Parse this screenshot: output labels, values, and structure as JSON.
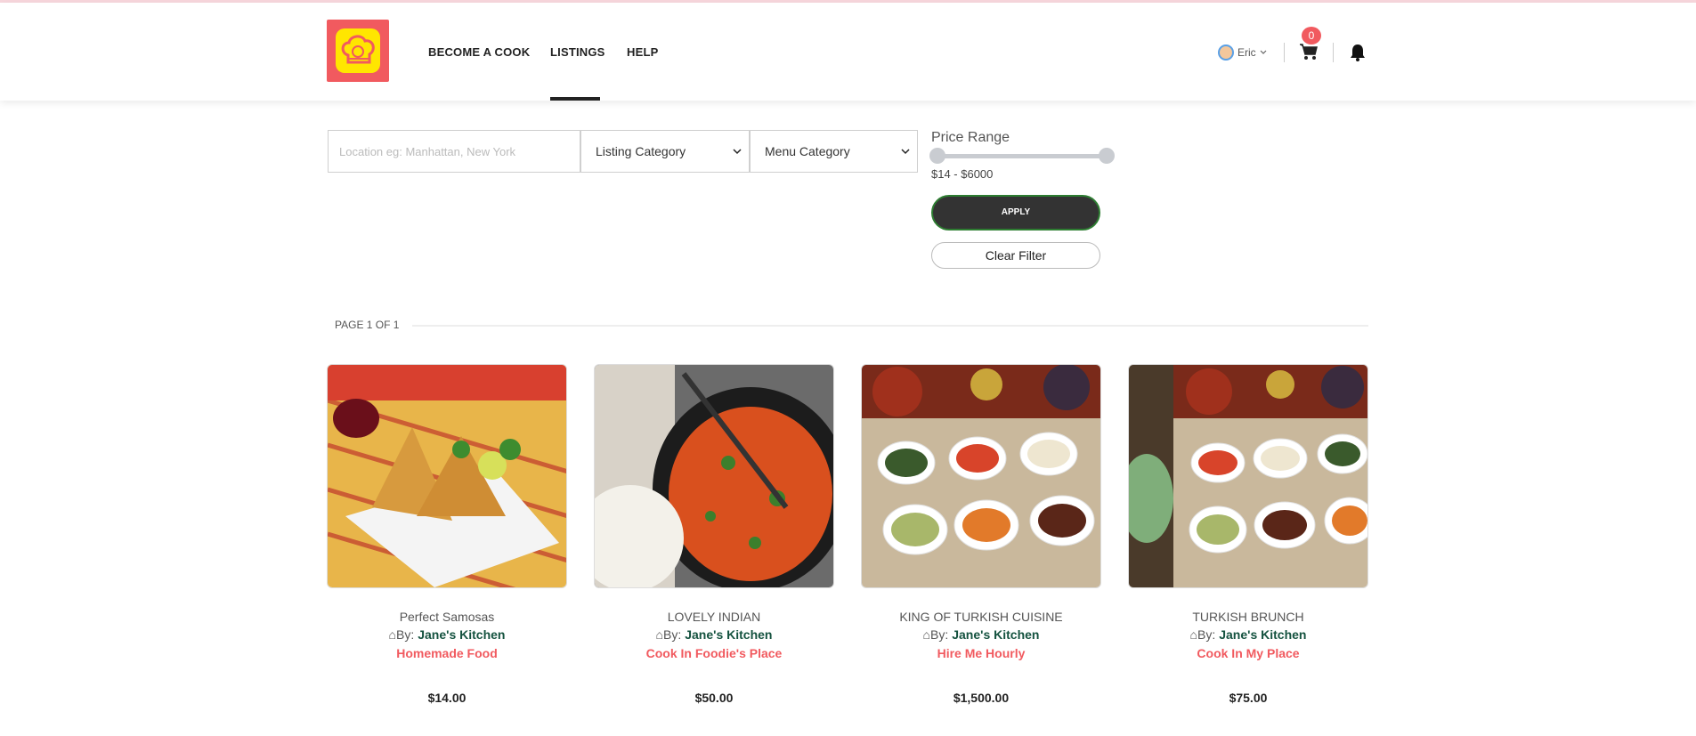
{
  "nav": {
    "become_cook": "BECOME A COOK",
    "listings": "LISTINGS",
    "help": "HELP"
  },
  "user": {
    "name": "Eric"
  },
  "cart": {
    "count": "0"
  },
  "filters": {
    "location_placeholder": "Location eg: Manhattan, New York",
    "listing_category": "Listing Category",
    "menu_category": "Menu Category",
    "price_title": "Price Range",
    "price_range": "$14 - $6000",
    "apply_label": "APPLY",
    "clear_label": "Clear Filter"
  },
  "pagination": {
    "label": "PAGE 1 OF 1"
  },
  "listings": [
    {
      "title": "Perfect Samosas",
      "by": "By:",
      "kitchen": "Jane's Kitchen",
      "category": "Homemade Food",
      "price": "$14.00"
    },
    {
      "title": "LOVELY INDIAN",
      "by": "By:",
      "kitchen": "Jane's Kitchen",
      "category": "Cook In Foodie's Place",
      "price": "$50.00"
    },
    {
      "title": "KING OF TURKISH CUISINE",
      "by": "By:",
      "kitchen": "Jane's Kitchen",
      "category": "Hire Me Hourly",
      "price": "$1,500.00"
    },
    {
      "title": "TURKISH BRUNCH",
      "by": "By:",
      "kitchen": "Jane's Kitchen",
      "category": "Cook In My Place",
      "price": "$75.00"
    }
  ],
  "colors": {
    "brand_red": "#f15a5f",
    "brand_yellow": "#ffe600",
    "kitchen_green": "#14523f"
  }
}
